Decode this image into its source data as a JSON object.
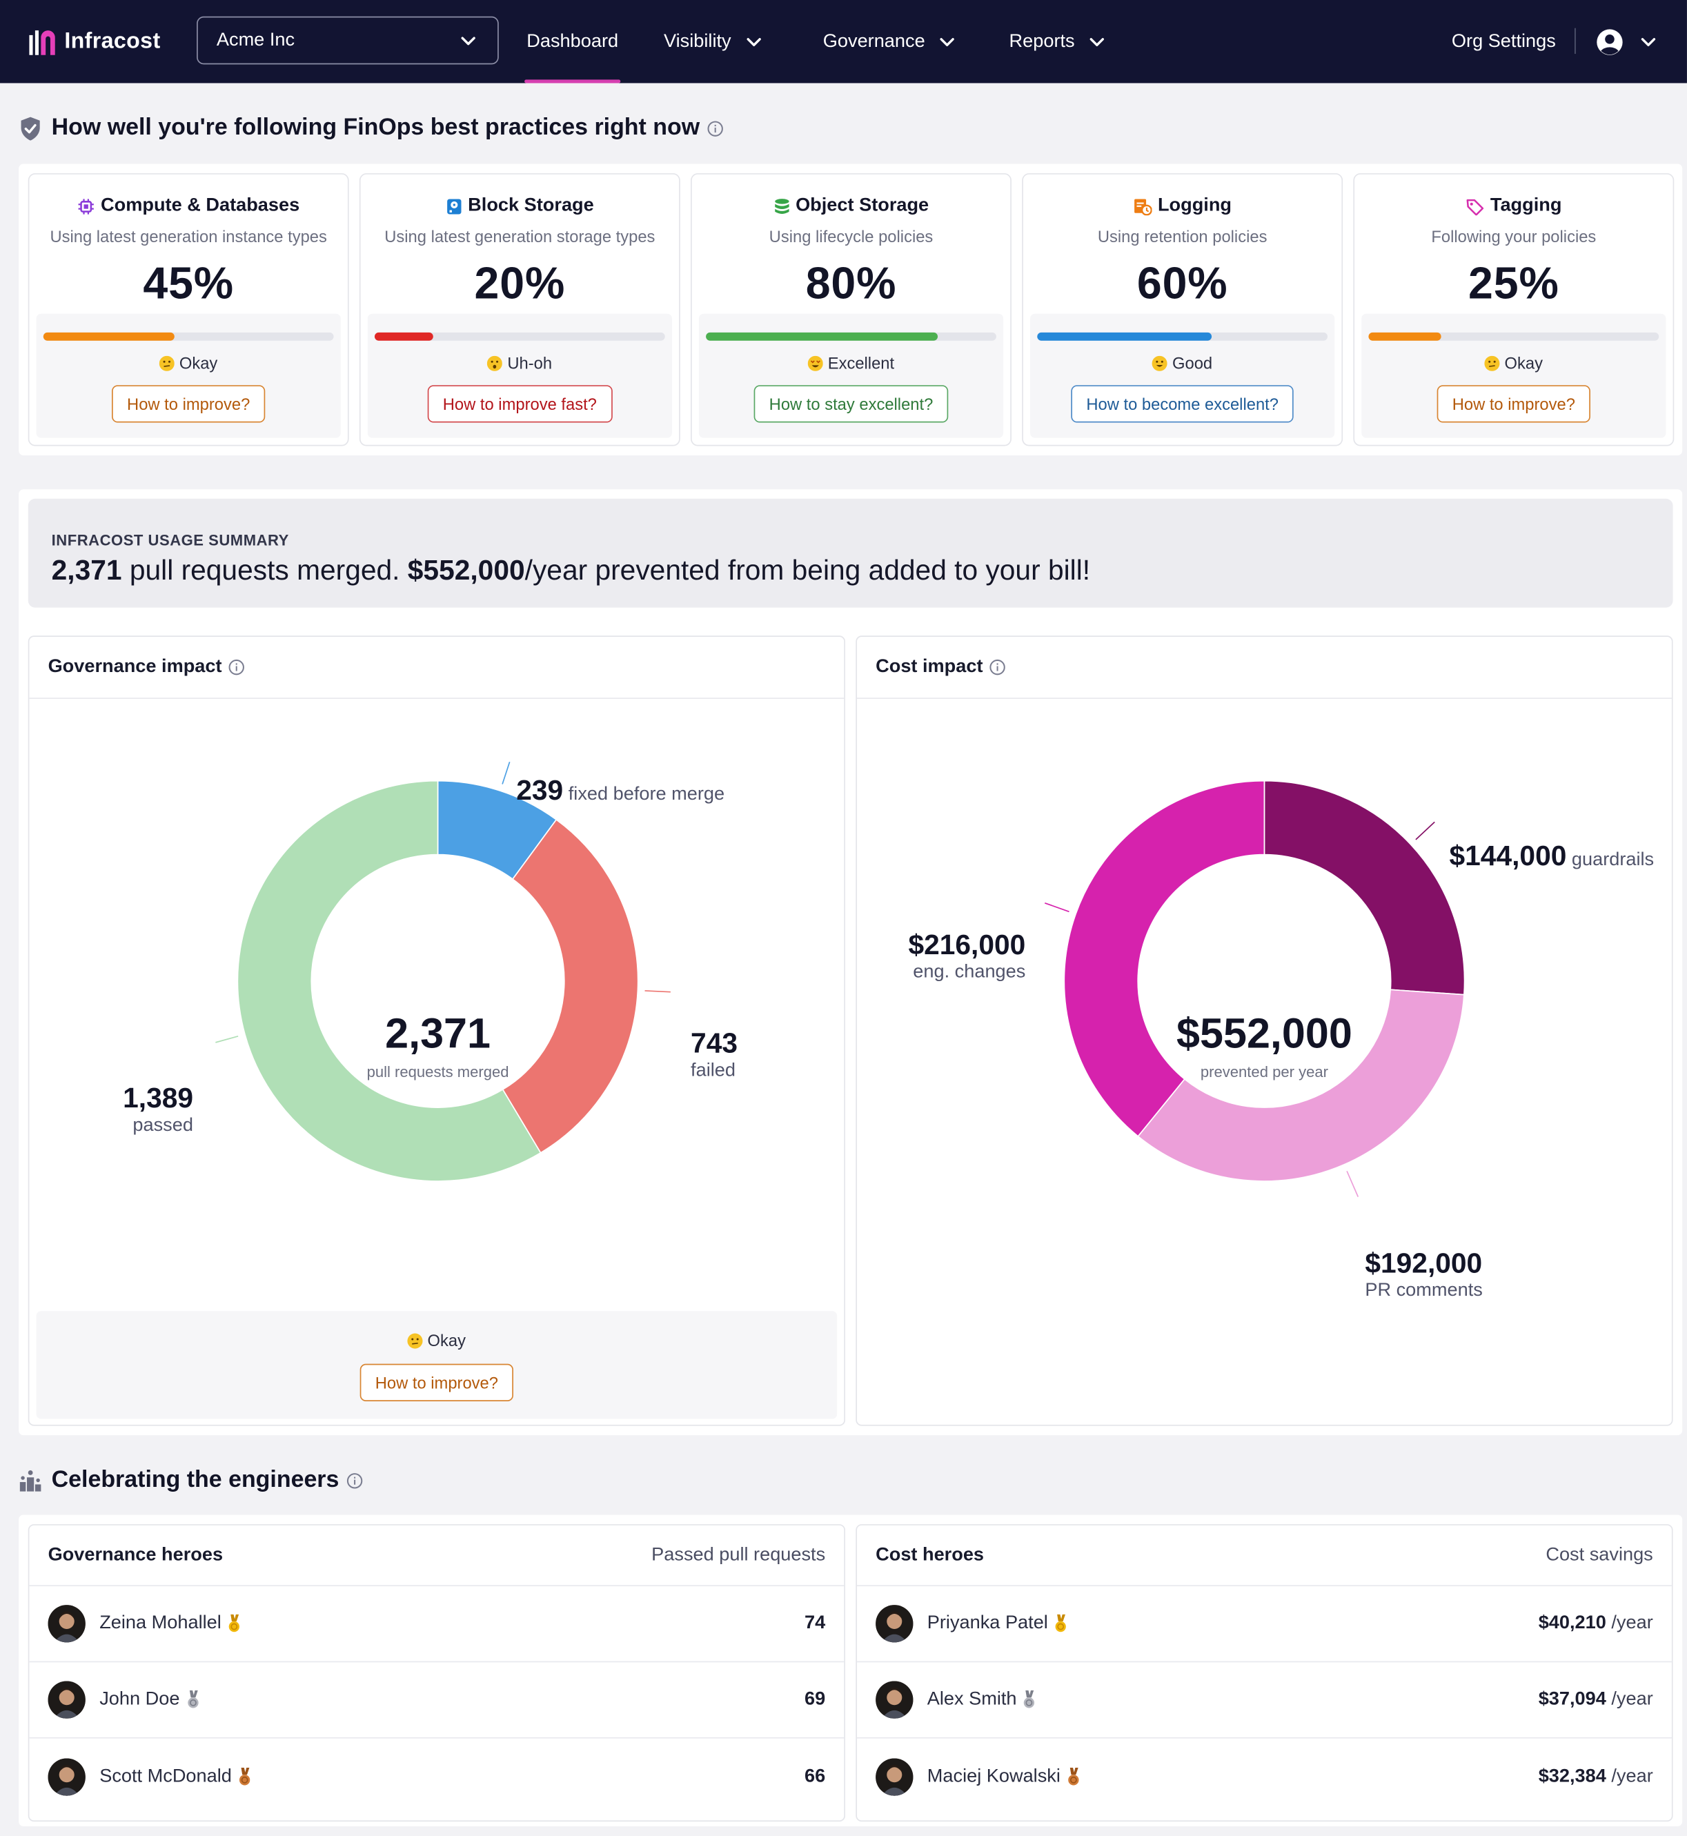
{
  "nav": {
    "brand": "Infracost",
    "org": "Acme Inc",
    "items": [
      {
        "label": "Dashboard",
        "active": true
      },
      {
        "label": "Visibility"
      },
      {
        "label": "Governance"
      },
      {
        "label": "Reports"
      }
    ],
    "org_settings": "Org Settings"
  },
  "best_practices": {
    "title": "How well you're following FinOps best practices right now",
    "cards": [
      {
        "icon": "chip-icon",
        "title": "Compute & Databases",
        "subtitle": "Using latest generation instance types",
        "percent": "45%",
        "progress": 0.45,
        "color": "#f28a12",
        "rating": "Okay",
        "button": "How to improve?"
      },
      {
        "icon": "disk-icon",
        "title": "Block Storage",
        "subtitle": "Using latest generation storage types",
        "percent": "20%",
        "progress": 0.2,
        "color": "#e02826",
        "rating": "Uh-oh",
        "button": "How to improve fast?"
      },
      {
        "icon": "database-icon",
        "title": "Object Storage",
        "subtitle": "Using lifecycle policies",
        "percent": "80%",
        "progress": 0.8,
        "color": "#4caf50",
        "rating": "Excellent",
        "button": "How to stay excellent?"
      },
      {
        "icon": "clock-doc-icon",
        "title": "Logging",
        "subtitle": "Using retention policies",
        "percent": "60%",
        "progress": 0.6,
        "color": "#2688d9",
        "rating": "Good",
        "button": "How to become excellent?"
      },
      {
        "icon": "tag-icon",
        "title": "Tagging",
        "subtitle": "Following your policies",
        "percent": "25%",
        "progress": 0.25,
        "color": "#f28a12",
        "rating": "Okay",
        "button": "How to improve?"
      }
    ]
  },
  "usage": {
    "label": "INFRACOST USAGE SUMMARY",
    "pr_count": "2,371",
    "pr_text": " pull requests merged. ",
    "amount": "$552,000",
    "amount_text": "/year prevented from being added to your bill!"
  },
  "governance": {
    "title": "Governance impact",
    "center_value": "2,371",
    "center_label": "pull requests merged",
    "slices": [
      {
        "num": "239",
        "label": "fixed before merge",
        "value": 239,
        "color": "#4ca0e4"
      },
      {
        "num": "743",
        "label": "failed",
        "value": 743,
        "color": "#ec7570"
      },
      {
        "num": "1,389",
        "label": "passed",
        "value": 1389,
        "color": "#b0dfb6"
      }
    ],
    "rating": "Okay",
    "button": "How to improve?"
  },
  "cost": {
    "title": "Cost impact",
    "center_value": "$552,000",
    "center_label": "prevented per year",
    "slices": [
      {
        "num": "$144,000",
        "label": "guardrails",
        "value": 144000,
        "color": "#841066"
      },
      {
        "num": "$192,000",
        "label": "PR comments",
        "value": 192000,
        "color": "#ec9fd9"
      },
      {
        "num": "$216,000",
        "label": "eng. changes",
        "value": 216000,
        "color": "#d622ad"
      }
    ]
  },
  "heroes": {
    "title": "Celebrating the engineers",
    "governance": {
      "title": "Governance heroes",
      "metric": "Passed pull requests",
      "rows": [
        {
          "name": "Zeina Mohallel",
          "medal": "gold",
          "value": "74"
        },
        {
          "name": "John Doe",
          "medal": "silver",
          "value": "69"
        },
        {
          "name": "Scott McDonald",
          "medal": "bronze",
          "value": "66"
        }
      ]
    },
    "cost": {
      "title": "Cost heroes",
      "metric": "Cost savings",
      "rows": [
        {
          "name": "Priyanka Patel",
          "medal": "gold",
          "value": "$40,210",
          "unit": " /year"
        },
        {
          "name": "Alex Smith",
          "medal": "silver",
          "value": "$37,094",
          "unit": " /year"
        },
        {
          "name": "Maciej Kowalski",
          "medal": "bronze",
          "value": "$32,384",
          "unit": " /year"
        }
      ]
    }
  }
}
